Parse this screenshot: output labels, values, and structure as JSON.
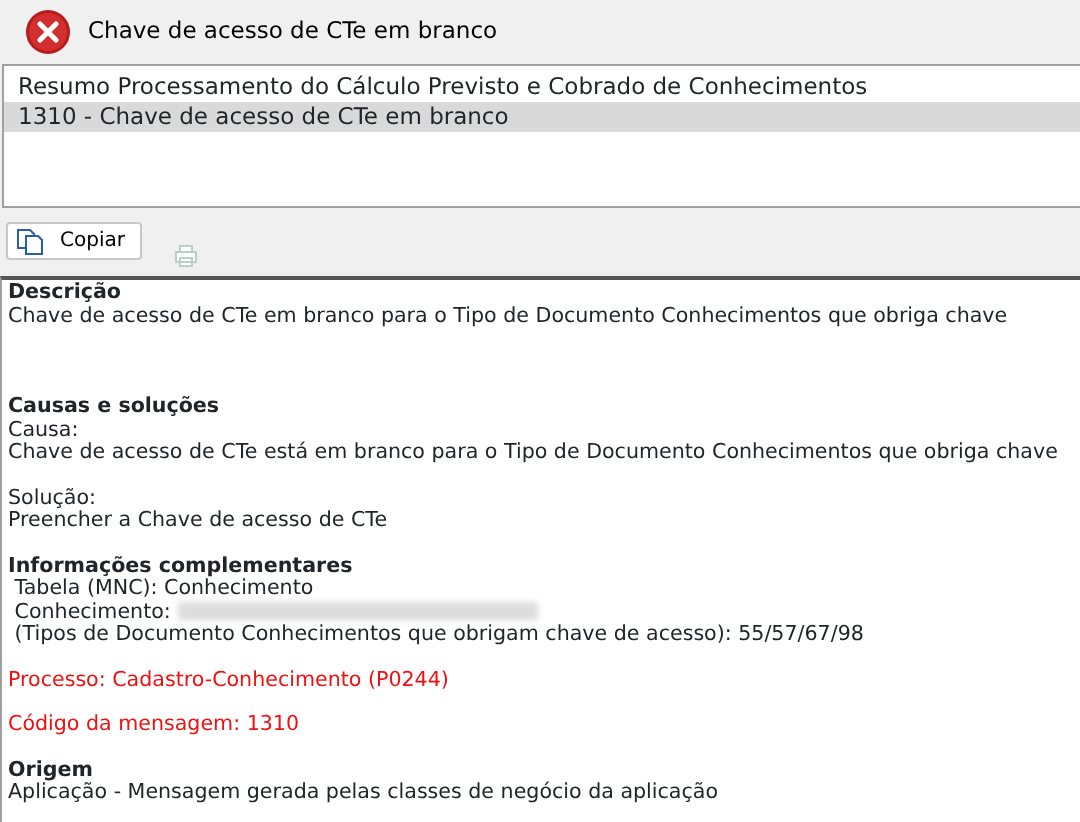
{
  "dialog": {
    "title": "Chave de acesso de CTe em branco",
    "error": true
  },
  "messages": [
    {
      "label": "Resumo Processamento do Cálculo Previsto e Cobrado de Conhecimentos",
      "selected": false
    },
    {
      "label": "1310 - Chave de acesso de CTe em branco",
      "selected": true
    }
  ],
  "toolbar": {
    "copy_button": "Copiar",
    "print_disabled": true
  },
  "details": [
    {
      "kind": "heading",
      "text": "Descrição"
    },
    {
      "kind": "text",
      "text": "Chave de acesso de CTe em branco para o Tipo de Documento Conhecimentos que obriga chave"
    },
    {
      "kind": "heading",
      "text": "Causas e soluções"
    },
    {
      "kind": "text",
      "text": "Causa:"
    },
    {
      "kind": "text",
      "text": "Chave de acesso de CTe está em branco para o Tipo de Documento Conhecimentos que obriga chave"
    },
    {
      "kind": "text",
      "text": "Solução:"
    },
    {
      "kind": "text",
      "text": "Preencher a Chave de acesso de CTe"
    },
    {
      "kind": "heading",
      "text": "Informações complementares"
    },
    {
      "kind": "text",
      "text": " Tabela (MNC): Conhecimento"
    },
    {
      "kind": "redacted",
      "text": " Conhecimento:"
    },
    {
      "kind": "text",
      "text": " (Tipos de Documento Conhecimentos que obrigam chave de acesso): 55/57/67/98"
    },
    {
      "kind": "alert",
      "text": "Processo: Cadastro-Conhecimento (P0244)"
    },
    {
      "kind": "alert",
      "text": "Código da mensagem: 1310"
    },
    {
      "kind": "heading",
      "text": "Origem"
    },
    {
      "kind": "text",
      "text": "Aplicação - Mensagem gerada pelas classes de negócio da aplicação"
    }
  ]
}
